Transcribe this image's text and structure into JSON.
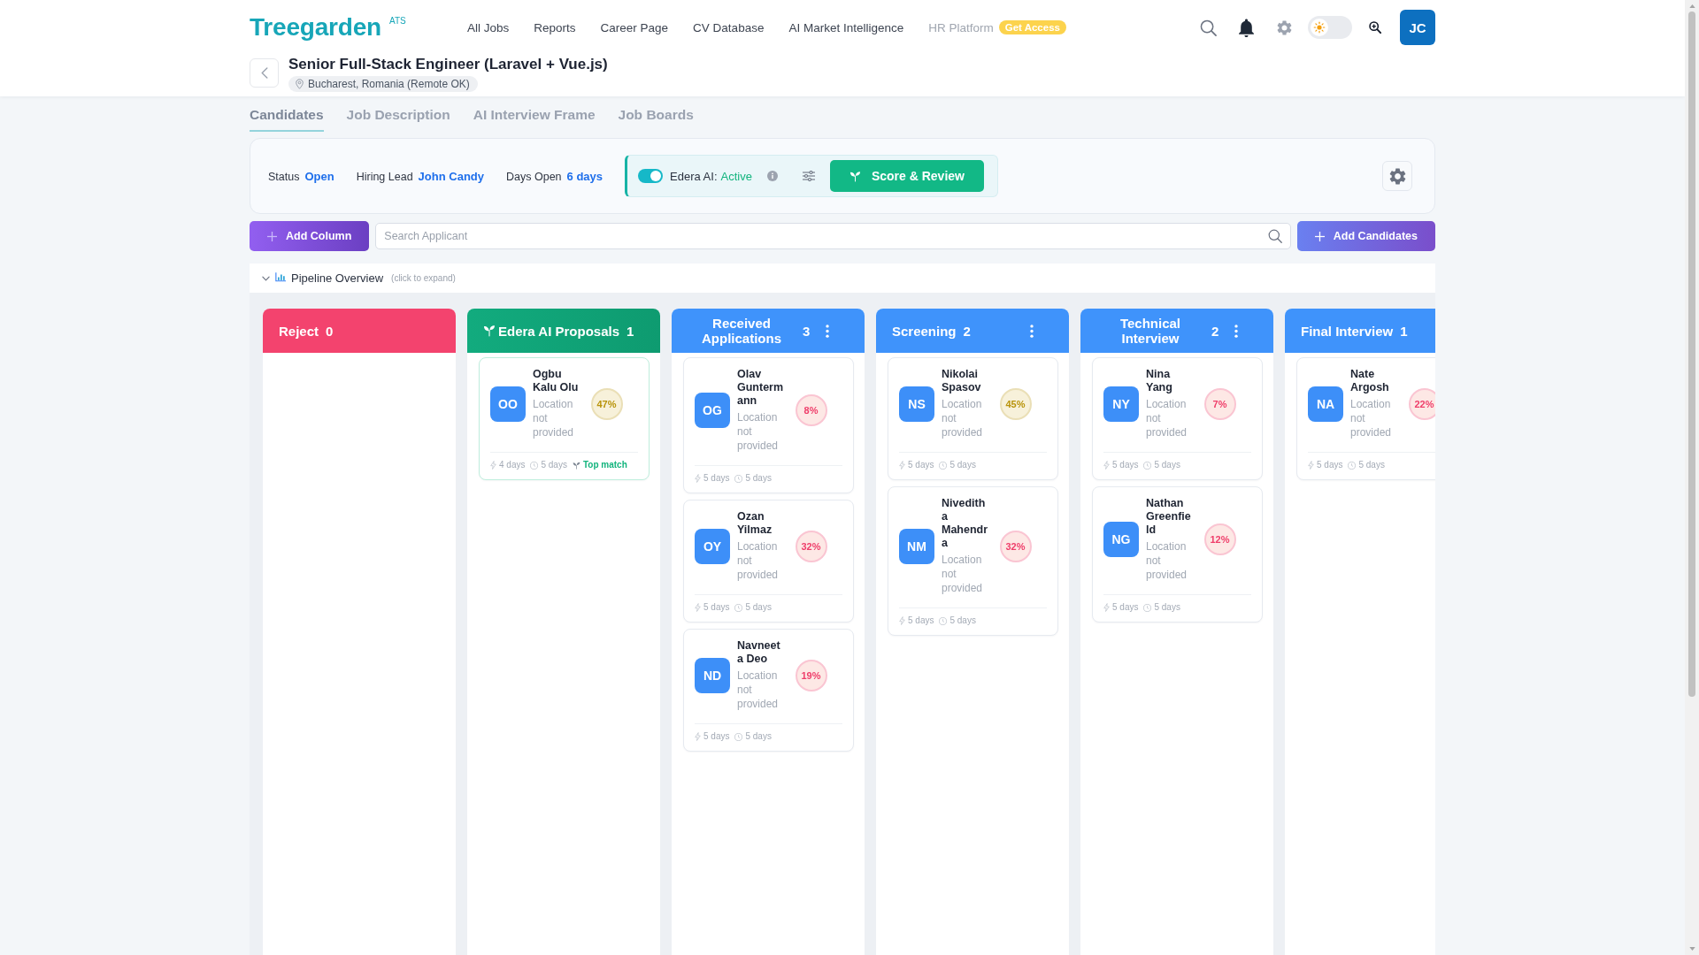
{
  "header": {
    "logo": "Treegarden",
    "logo_tag": "ATS",
    "nav": [
      {
        "label": "All Jobs",
        "disabled": false
      },
      {
        "label": "Reports",
        "disabled": false
      },
      {
        "label": "Career Page",
        "disabled": false
      },
      {
        "label": "CV Database",
        "disabled": false
      },
      {
        "label": "AI Market Intelligence",
        "disabled": false
      },
      {
        "label": "HR Platform",
        "disabled": true,
        "badge": "Get Access"
      }
    ],
    "theme_toggle": {
      "on": false
    },
    "user_initials": "JC"
  },
  "job": {
    "title": "Senior Full-Stack Engineer (Laravel + Vue.js)",
    "location": "Bucharest, Romania (Remote OK)"
  },
  "tabs": [
    {
      "label": "Candidates",
      "selected": true
    },
    {
      "label": "Job Description",
      "selected": false
    },
    {
      "label": "AI Interview Frame",
      "selected": false
    },
    {
      "label": "Job Boards",
      "selected": false
    }
  ],
  "summary": {
    "fields": [
      {
        "label": "Status",
        "value": "Open"
      },
      {
        "label": "Hiring Lead",
        "value": "John Candy"
      },
      {
        "label": "Days Open",
        "value": "6 days"
      }
    ],
    "ai_assistant": {
      "label": "Edera AI:",
      "status": "Active",
      "on": true
    },
    "action": "Score & Review"
  },
  "toolbar": {
    "add_column": "Add Column",
    "search": {
      "placeholder": "Search Applicant"
    },
    "add_candidates": "Add Candidates"
  },
  "pipeline_overview": {
    "title": "Pipeline Overview",
    "hint": "(click to expand)",
    "expanded": false
  },
  "columns": [
    {
      "title": "Reject",
      "count": "0",
      "kind": "reject",
      "menu": false
    },
    {
      "title": "Edera AI Proposals",
      "count": "1",
      "kind": "ai",
      "menu": false,
      "cards": [
        {
          "initials": "OO",
          "name": "Ogbu Kalu Olu",
          "location": "Location not provided",
          "score": {
            "text": "47%",
            "color": "#b8930a"
          },
          "highlighted": true,
          "footer": [
            {
              "kind": "bolt",
              "text": "4 days"
            },
            {
              "kind": "clock",
              "text": "5 days"
            },
            {
              "kind": "match",
              "text": "Top match"
            }
          ]
        }
      ]
    },
    {
      "title": "Received Applications",
      "count": "3",
      "kind": "stage",
      "menu": true,
      "cards": [
        {
          "initials": "OG",
          "name": "Olav Guntermann",
          "location": "Location not provided",
          "score": {
            "text": "8%",
            "color": "#ef3e6a"
          },
          "highlighted": false,
          "footer": [
            {
              "kind": "bolt",
              "text": "5 days"
            },
            {
              "kind": "clock",
              "text": "5 days"
            }
          ]
        },
        {
          "initials": "OY",
          "name": "Ozan Yilmaz",
          "location": "Location not provided",
          "score": {
            "text": "32%",
            "color": "#ef3e6a"
          },
          "highlighted": false,
          "footer": [
            {
              "kind": "bolt",
              "text": "5 days"
            },
            {
              "kind": "clock",
              "text": "5 days"
            }
          ]
        },
        {
          "initials": "ND",
          "name": "Navneeta Deo",
          "location": "Location not provided",
          "score": {
            "text": "19%",
            "color": "#ef3e6a"
          },
          "highlighted": false,
          "footer": [
            {
              "kind": "bolt",
              "text": "5 days"
            },
            {
              "kind": "clock",
              "text": "5 days"
            }
          ]
        }
      ]
    },
    {
      "title": "Screening",
      "count": "2",
      "kind": "stage",
      "menu": true,
      "cards": [
        {
          "initials": "NS",
          "name": "Nikolai Spasov",
          "location": "Location not provided",
          "score": {
            "text": "45%",
            "color": "#b8930a"
          },
          "highlighted": false,
          "footer": [
            {
              "kind": "bolt",
              "text": "5 days"
            },
            {
              "kind": "clock",
              "text": "5 days"
            }
          ]
        },
        {
          "initials": "NM",
          "name": "Niveditha Mahendra",
          "location": "Location not provided",
          "score": {
            "text": "32%",
            "color": "#ef3e6a"
          },
          "highlighted": false,
          "footer": [
            {
              "kind": "bolt",
              "text": "5 days"
            },
            {
              "kind": "clock",
              "text": "5 days"
            }
          ]
        }
      ]
    },
    {
      "title": "Technical Interview",
      "count": "2",
      "kind": "stage",
      "menu": true,
      "cards": [
        {
          "initials": "NY",
          "name": "Nina Yang",
          "location": "Location not provided",
          "score": {
            "text": "7%",
            "color": "#ef3e6a"
          },
          "highlighted": false,
          "footer": [
            {
              "kind": "bolt",
              "text": "5 days"
            },
            {
              "kind": "clock",
              "text": "5 days"
            }
          ]
        },
        {
          "initials": "NG",
          "name": "Nathan Greenfield",
          "location": "Location not provided",
          "score": {
            "text": "12%",
            "color": "#ef3e6a"
          },
          "highlighted": false,
          "footer": [
            {
              "kind": "bolt",
              "text": "5 days"
            },
            {
              "kind": "clock",
              "text": "5 days"
            }
          ]
        }
      ]
    },
    {
      "title": "Final Interview",
      "count": "1",
      "kind": "stage",
      "cards": [
        {
          "initials": "NA",
          "name": "Nate Argosh",
          "location": "Location not provided",
          "score": {
            "text": "22%",
            "color": "#ef3e6a"
          },
          "highlighted": false,
          "footer": [
            {
              "kind": "bolt",
              "text": "5 days"
            },
            {
              "kind": "clock",
              "text": "5 days"
            }
          ]
        }
      ]
    }
  ]
}
